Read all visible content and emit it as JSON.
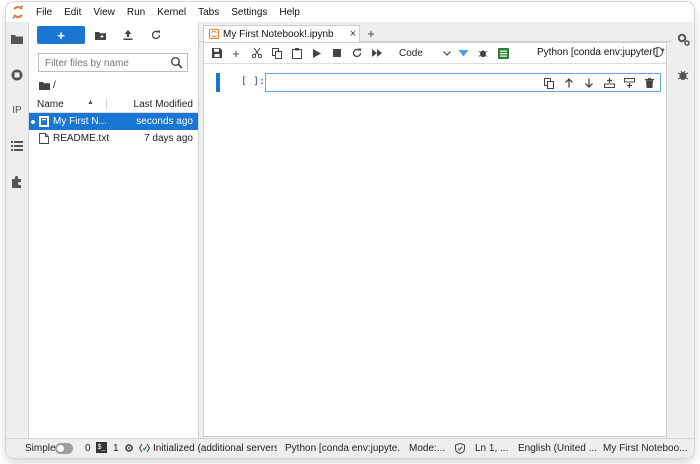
{
  "menu": [
    "File",
    "Edit",
    "View",
    "Run",
    "Kernel",
    "Tabs",
    "Settings",
    "Help"
  ],
  "filebrowser": {
    "new_label": "+",
    "filter_placeholder": "Filter files by name",
    "breadcrumb": "/",
    "col_name": "Name",
    "col_modified": "Last Modified",
    "files": [
      {
        "name": "My First N...",
        "modified": "seconds ago",
        "selected": true,
        "running": true,
        "type": "notebook"
      },
      {
        "name": "README.txt",
        "modified": "7 days ago",
        "selected": false,
        "running": false,
        "type": "text"
      }
    ]
  },
  "tabs": [
    {
      "label": "My First Notebook!.ipynb",
      "close": "×"
    }
  ],
  "tab_add": "+",
  "notebook": {
    "cell_type": "Code",
    "kernel": "Python [conda env:jupyter!] *",
    "prompt": "[ ]:"
  },
  "status": {
    "simple_label": "Simple",
    "count0": "0",
    "count1": "1",
    "init": "Initialized (additional servers n",
    "kernel": "Python [conda env:jupyte...",
    "mode": "Mode:...",
    "position": "Ln 1, ...",
    "language": "English (United ...",
    "doc": "My First Noteboo..."
  },
  "colors": {
    "accent": "#1976d2",
    "orange": "#f37726",
    "green": "#2e7d32"
  }
}
